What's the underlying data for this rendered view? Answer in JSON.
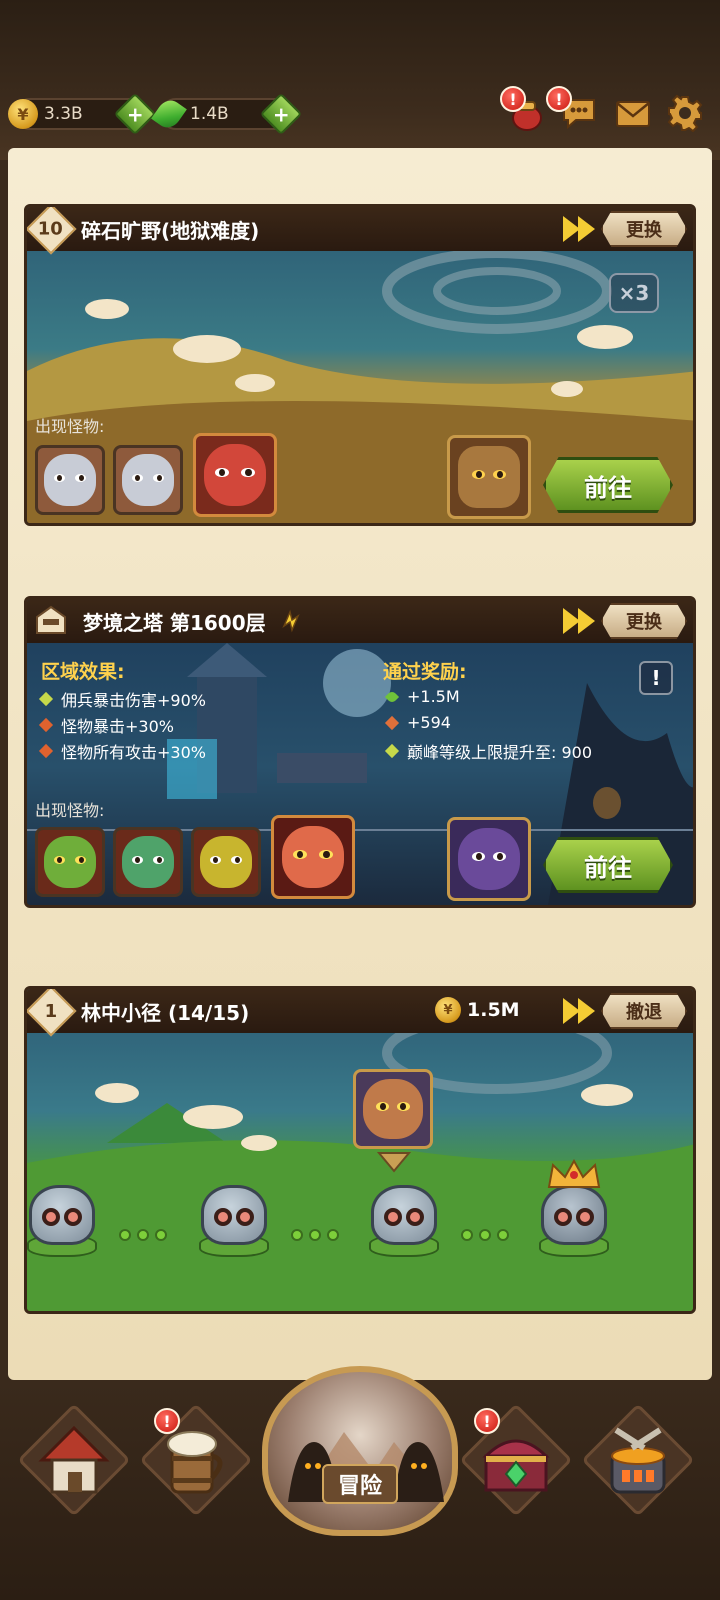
{
  "resources": {
    "gold": {
      "value": "3.3B",
      "icon": "coin-icon"
    },
    "gems": {
      "value": "1.4B",
      "icon": "gem-icon"
    },
    "plus_label": "+"
  },
  "alerts": {
    "mark": "!"
  },
  "stage_card_1": {
    "level": "10",
    "title": "碎石旷野(地狱难度)",
    "swap_label": "更换",
    "multiplier": "×3",
    "monsters_label": "出现怪物:",
    "go_label": "前往"
  },
  "stage_card_2": {
    "title": "梦境之塔 第1600层",
    "swap_label": "更换",
    "effects_title": "区域效果:",
    "effects": [
      "佣兵暴击伤害+90%",
      "怪物暴击+30%",
      "怪物所有攻击+30%"
    ],
    "effect_colors": [
      "#c6d94a",
      "#e0622e",
      "#e0622e"
    ],
    "rewards_title": "通过奖励:",
    "rewards": [
      "+1.5M",
      "+594",
      "巅峰等级上限提升至: 900"
    ],
    "monsters_label": "出现怪物:",
    "go_label": "前往",
    "info_mark": "!"
  },
  "stage_card_3": {
    "level": "1",
    "title": "林中小径 (14/15)",
    "gold_reward": "1.5M",
    "retreat_label": "撤退"
  },
  "bottom_nav": {
    "adventure_label": "冒险",
    "items": [
      "town-icon",
      "tavern-icon",
      "adventure-portal",
      "treasure-chest-icon",
      "forge-icon"
    ]
  },
  "colors": {
    "accent_gold": "#ffd24d",
    "go_green": "#7db33a",
    "frame_brown": "#3b2717"
  }
}
